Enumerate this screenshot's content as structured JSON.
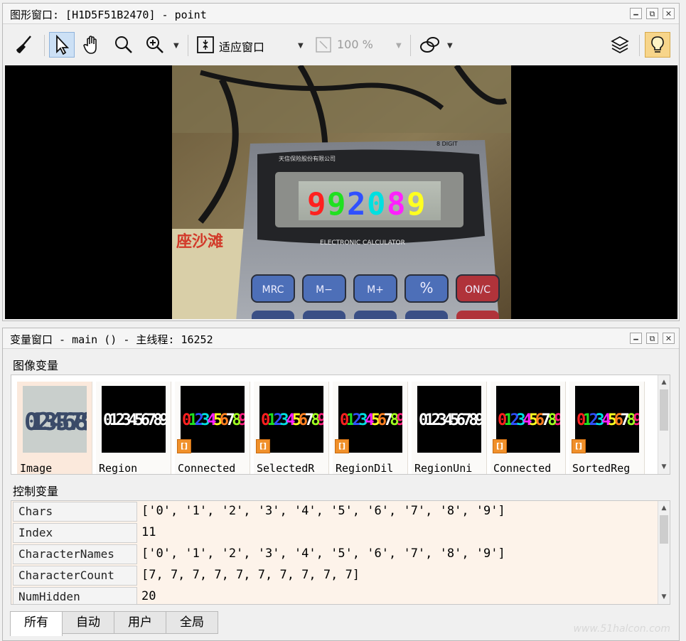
{
  "graphics_window": {
    "title": "图形窗口: [H1D5F51B2470] - point",
    "controls": [
      "🗕",
      "⧉",
      "✕"
    ],
    "toolbar": {
      "fit_window_label": "适应窗口",
      "zoom_value": "100 %"
    },
    "display": {
      "digits": [
        {
          "char": "9",
          "color": "#ff2020"
        },
        {
          "char": "9",
          "color": "#20e020"
        },
        {
          "char": "2",
          "color": "#3050ff"
        },
        {
          "char": "0",
          "color": "#00e0e0"
        },
        {
          "char": "8",
          "color": "#ff20ff"
        },
        {
          "char": "9",
          "color": "#ffff20"
        }
      ],
      "brand": "ELECTRONIC CALCULATOR",
      "top_label": "8 DIGIT",
      "keys": [
        "MRC",
        "M−",
        "M+",
        "%",
        "ON/C"
      ],
      "poster_text": "座沙滩"
    }
  },
  "variable_window": {
    "title": "变量窗口 - main () - 主线程: 16252",
    "controls": [
      "🗕",
      "⧉",
      "✕"
    ],
    "image_section_label": "图像变量",
    "images": [
      {
        "name": "Image",
        "kind": "gray",
        "text": "0123456789",
        "badge": false
      },
      {
        "name": "Region",
        "kind": "white",
        "text": "0123456789",
        "badge": false
      },
      {
        "name": "Connected",
        "kind": "color",
        "text": "0123456789",
        "badge": true
      },
      {
        "name": "SelectedR",
        "kind": "color",
        "text": "0123456789",
        "badge": true
      },
      {
        "name": "RegionDil",
        "kind": "color",
        "text": "0123456789",
        "badge": true
      },
      {
        "name": "RegionUni",
        "kind": "white",
        "text": "0123456789",
        "badge": false
      },
      {
        "name": "Connected",
        "kind": "color",
        "text": "0123456789",
        "badge": true
      },
      {
        "name": "SortedReg",
        "kind": "color",
        "text": "0123456789",
        "badge": true
      }
    ],
    "badge_glyph": "[]",
    "control_section_label": "控制变量",
    "control_vars": [
      {
        "name": "Chars",
        "value": "['0', '1', '2', '3', '4', '5', '6', '7', '8', '9']"
      },
      {
        "name": "Index",
        "value": "11"
      },
      {
        "name": "CharacterNames",
        "value": "['0', '1', '2', '3', '4', '5', '6', '7', '8', '9']"
      },
      {
        "name": "CharacterCount",
        "value": "[7, 7, 7, 7, 7, 7, 7, 7, 7, 7]"
      },
      {
        "name": "NumHidden",
        "value": "20"
      }
    ],
    "tabs": [
      "所有",
      "自动",
      "用户",
      "全局"
    ],
    "active_tab": "所有",
    "watermark": "www.51halcon.com"
  },
  "colors": {
    "digit_palette": [
      "#ff2020",
      "#20e020",
      "#3050ff",
      "#00e0e0",
      "#ff20ff",
      "#ffff20",
      "#ff8020",
      "#ffffff",
      "#a0ff20",
      "#ff2080"
    ],
    "badge": "#f0902a",
    "control_bg": "#fdf3ea"
  }
}
